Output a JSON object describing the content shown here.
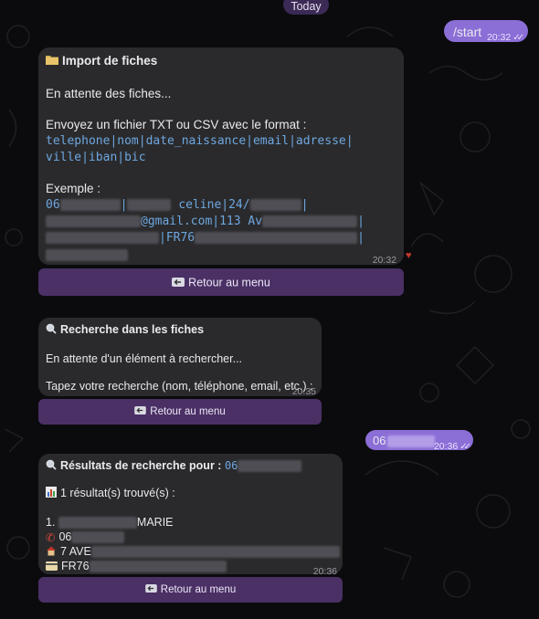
{
  "date_pill": "Today",
  "outgoing": [
    {
      "text": "/start",
      "time": "20:32"
    },
    {
      "text": "06",
      "time": "20:36"
    }
  ],
  "import_msg": {
    "title": "Import de fiches",
    "waiting": "En attente des fiches...",
    "instruction": "Envoyez un fichier TXT ou CSV avec le format :",
    "format_line1": "telephone|nom|date_naissance|email|adresse|",
    "format_line2": "ville|iban|bic",
    "example_label": "Exemple :",
    "ex_phone": "06",
    "ex_name": "celine|24/",
    "ex_email": "@gmail.com|113 Av",
    "ex_iban": "|FR76",
    "time": "20:32",
    "button": "Retour au menu"
  },
  "search_msg": {
    "title": "Recherche dans les fiches",
    "waiting": "En attente d'un élément à rechercher...",
    "prompt": "Tapez votre recherche (nom, téléphone, email, etc.) :",
    "time": "20:35",
    "button": "Retour au menu"
  },
  "results_msg": {
    "title": "Résultats de recherche pour :",
    "query": "06",
    "count": "1 résultat(s) trouvé(s) :",
    "item_index": "1.",
    "item_name": "MARIE",
    "phone": "06",
    "address": "7 AVE",
    "iban": "FR76",
    "time": "20:36",
    "button": "Retour au menu"
  },
  "icons": {
    "folder": "folder-icon",
    "search": "search-icon",
    "back": "back-arrow-icon",
    "chart": "bar-chart-icon",
    "phone": "telephone-icon",
    "house": "house-icon",
    "card": "credit-card-icon",
    "heart": "heart-reaction-icon",
    "read": "double-check-icon"
  },
  "colors": {
    "accent": "#8b6ed6",
    "button_bg": "#4a3065",
    "bubble_bg": "#2a2a2c",
    "mono_link": "#6ea7e0"
  }
}
